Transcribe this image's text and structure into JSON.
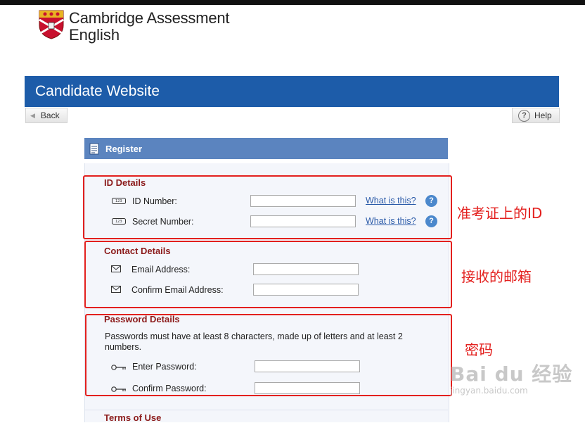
{
  "logo": {
    "line1": "Cambridge Assessment",
    "line2": "English"
  },
  "banner": {
    "title": "Candidate Website"
  },
  "nav": {
    "back_label": "Back",
    "help_label": "Help"
  },
  "panel": {
    "title": "Register"
  },
  "id_details": {
    "heading": "ID Details",
    "id_number_label": "ID Number:",
    "id_number_value": "",
    "secret_number_label": "Secret Number:",
    "secret_number_value": "",
    "what_is_this": "What is this?"
  },
  "contact_details": {
    "heading": "Contact Details",
    "email_label": "Email Address:",
    "email_value": "",
    "confirm_email_label": "Confirm Email Address:",
    "confirm_email_value": ""
  },
  "password_details": {
    "heading": "Password Details",
    "description": "Passwords must have at least 8 characters, made up of letters and at least 2 numbers.",
    "enter_label": "Enter Password:",
    "confirm_label": "Confirm Password:"
  },
  "terms": {
    "heading": "Terms of Use"
  },
  "annotations": {
    "id_note": "准考证上的ID",
    "email_note": "接收的邮箱",
    "password_note": "密码"
  },
  "watermark": {
    "logo": "Bai du 经验",
    "url": "jingyan.baidu.com"
  },
  "colors": {
    "accent": "#1d5ca9",
    "panel_head": "#5b84bf",
    "section_heading": "#8b1a1a",
    "annotation_red": "#e3201e"
  }
}
